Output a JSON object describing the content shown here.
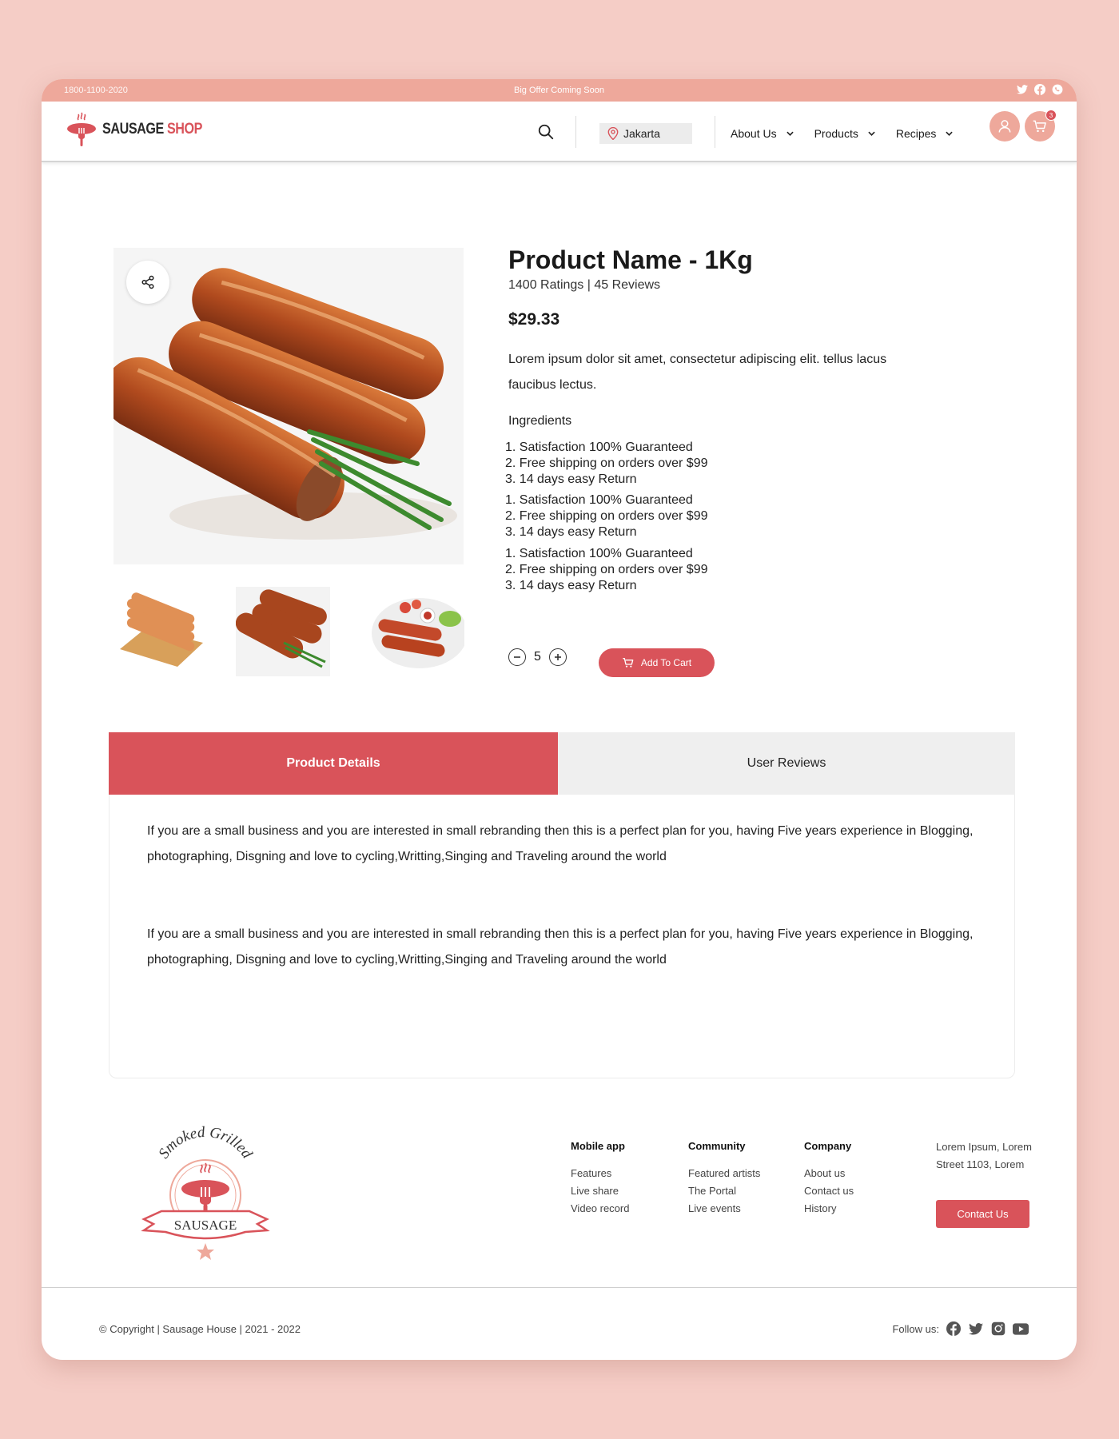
{
  "topbar": {
    "phone": "1800-1100-2020",
    "offer": "Big Offer Coming Soon",
    "social_icons": [
      "twitter-icon",
      "facebook-icon",
      "whatsapp-icon"
    ]
  },
  "header": {
    "logo_text_dark": "SAUSAGE",
    "logo_text_accent": "SHOP",
    "location": "Jakarta",
    "nav": [
      {
        "label": "About Us"
      },
      {
        "label": "Products"
      },
      {
        "label": "Recipes"
      }
    ],
    "cart_count": "3"
  },
  "product": {
    "name": "Product Name - 1Kg",
    "ratings": "1400 Ratings | 45 Reviews",
    "price": "$29.33",
    "description": "Lorem ipsum dolor sit amet, consectetur adipiscing elit. tellus lacus faucibus lectus.",
    "ingredients_title": "Ingredients",
    "ingredient_groups": [
      [
        "1. Satisfaction 100% Guaranteed",
        "2. Free shipping on orders over $99",
        "3. 14 days easy Return"
      ],
      [
        "1. Satisfaction 100% Guaranteed",
        "2. Free shipping on orders over $99",
        "3. 14 days easy Return"
      ],
      [
        "1. Satisfaction 100% Guaranteed",
        "2. Free shipping on orders over $99",
        "3. 14 days easy Return"
      ]
    ],
    "quantity": "5",
    "add_to_cart": "Add To Cart"
  },
  "tabs": {
    "active": "Product Details",
    "inactive": "User Reviews",
    "paragraphs": [
      "If you are a small business and you are interested in small rebranding then this is a perfect plan for you, having Five years experience in Blogging, photographing, Disgning and love to cycling,Writting,Singing and Traveling around the world",
      "If you are a small business and you are interested in small rebranding then this is a perfect plan for you, having Five years experience in Blogging, photographing, Disgning and love to cycling,Writting,Singing and Traveling around the world"
    ]
  },
  "footer": {
    "logo_arc_top": "Smoked Grilled",
    "logo_banner": "SAUSAGE",
    "columns": [
      {
        "heading": "Mobile app",
        "links": [
          "Features",
          "Live share",
          "Video record"
        ]
      },
      {
        "heading": "Community",
        "links": [
          "Featured artists",
          "The Portal",
          "Live events"
        ]
      },
      {
        "heading": "Company",
        "links": [
          "About us",
          "Contact us",
          "History"
        ]
      }
    ],
    "address": "Lorem Ipsum, Lorem Street 1103, Lorem",
    "contact_button": "Contact Us",
    "copyright": "© Copyright | Sausage House | 2021 - 2022",
    "follow_label": "Follow us:",
    "follow_icons": [
      "facebook-icon",
      "twitter-icon",
      "instagram-icon",
      "youtube-icon"
    ]
  },
  "colors": {
    "accent": "#d9535a",
    "topbar": "#eea89b",
    "background": "#f5cdc6"
  }
}
